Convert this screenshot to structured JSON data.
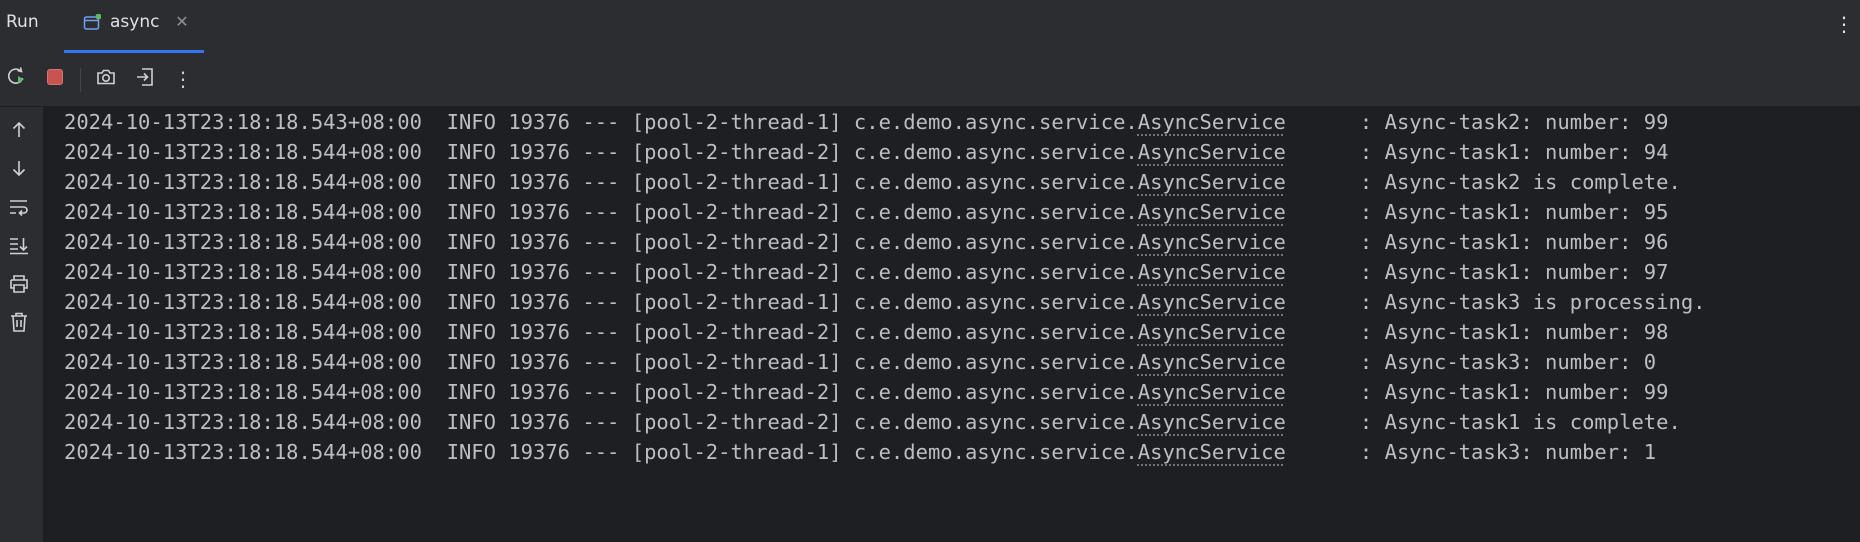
{
  "run_panel": {
    "title": "Run",
    "tab": {
      "label": "async"
    },
    "menu_icon": "more-vertical-icon"
  },
  "toolbar": {
    "buttons": [
      {
        "icon": "rerun-icon"
      },
      {
        "icon": "stop-icon",
        "color": "#c75450"
      },
      {
        "icon": "camera-icon"
      },
      {
        "icon": "exit-icon"
      },
      {
        "icon": "more-vertical-icon"
      }
    ]
  },
  "gutter": {
    "buttons": [
      {
        "icon": "arrow-up-icon"
      },
      {
        "icon": "arrow-down-icon"
      },
      {
        "icon": "soft-wrap-icon"
      },
      {
        "icon": "scroll-to-end-icon"
      },
      {
        "icon": "print-icon"
      },
      {
        "icon": "trash-icon"
      }
    ]
  },
  "console": {
    "lines": [
      {
        "prefix": "2024-10-13T23:18:18.543+08:00  INFO 19376 --- [pool-2-thread-1] c.e.demo.async.service.",
        "class": "AsyncService",
        "message": "      : Async-task2: number: 99"
      },
      {
        "prefix": "2024-10-13T23:18:18.544+08:00  INFO 19376 --- [pool-2-thread-2] c.e.demo.async.service.",
        "class": "AsyncService",
        "message": "      : Async-task1: number: 94"
      },
      {
        "prefix": "2024-10-13T23:18:18.544+08:00  INFO 19376 --- [pool-2-thread-1] c.e.demo.async.service.",
        "class": "AsyncService",
        "message": "      : Async-task2 is complete."
      },
      {
        "prefix": "2024-10-13T23:18:18.544+08:00  INFO 19376 --- [pool-2-thread-2] c.e.demo.async.service.",
        "class": "AsyncService",
        "message": "      : Async-task1: number: 95"
      },
      {
        "prefix": "2024-10-13T23:18:18.544+08:00  INFO 19376 --- [pool-2-thread-2] c.e.demo.async.service.",
        "class": "AsyncService",
        "message": "      : Async-task1: number: 96"
      },
      {
        "prefix": "2024-10-13T23:18:18.544+08:00  INFO 19376 --- [pool-2-thread-2] c.e.demo.async.service.",
        "class": "AsyncService",
        "message": "      : Async-task1: number: 97"
      },
      {
        "prefix": "2024-10-13T23:18:18.544+08:00  INFO 19376 --- [pool-2-thread-1] c.e.demo.async.service.",
        "class": "AsyncService",
        "message": "      : Async-task3 is processing."
      },
      {
        "prefix": "2024-10-13T23:18:18.544+08:00  INFO 19376 --- [pool-2-thread-2] c.e.demo.async.service.",
        "class": "AsyncService",
        "message": "      : Async-task1: number: 98"
      },
      {
        "prefix": "2024-10-13T23:18:18.544+08:00  INFO 19376 --- [pool-2-thread-1] c.e.demo.async.service.",
        "class": "AsyncService",
        "message": "      : Async-task3: number: 0"
      },
      {
        "prefix": "2024-10-13T23:18:18.544+08:00  INFO 19376 --- [pool-2-thread-2] c.e.demo.async.service.",
        "class": "AsyncService",
        "message": "      : Async-task1: number: 99"
      },
      {
        "prefix": "2024-10-13T23:18:18.544+08:00  INFO 19376 --- [pool-2-thread-2] c.e.demo.async.service.",
        "class": "AsyncService",
        "message": "      : Async-task1 is complete."
      },
      {
        "prefix": "2024-10-13T23:18:18.544+08:00  INFO 19376 --- [pool-2-thread-1] c.e.demo.async.service.",
        "class": "AsyncService",
        "message": "      : Async-task3: number: 1"
      }
    ]
  },
  "colors": {
    "background": "#1e1f22",
    "panel": "#2b2d30",
    "accent": "#3574f0",
    "text": "#bcbec4",
    "tab_badge": "#5fb865"
  }
}
